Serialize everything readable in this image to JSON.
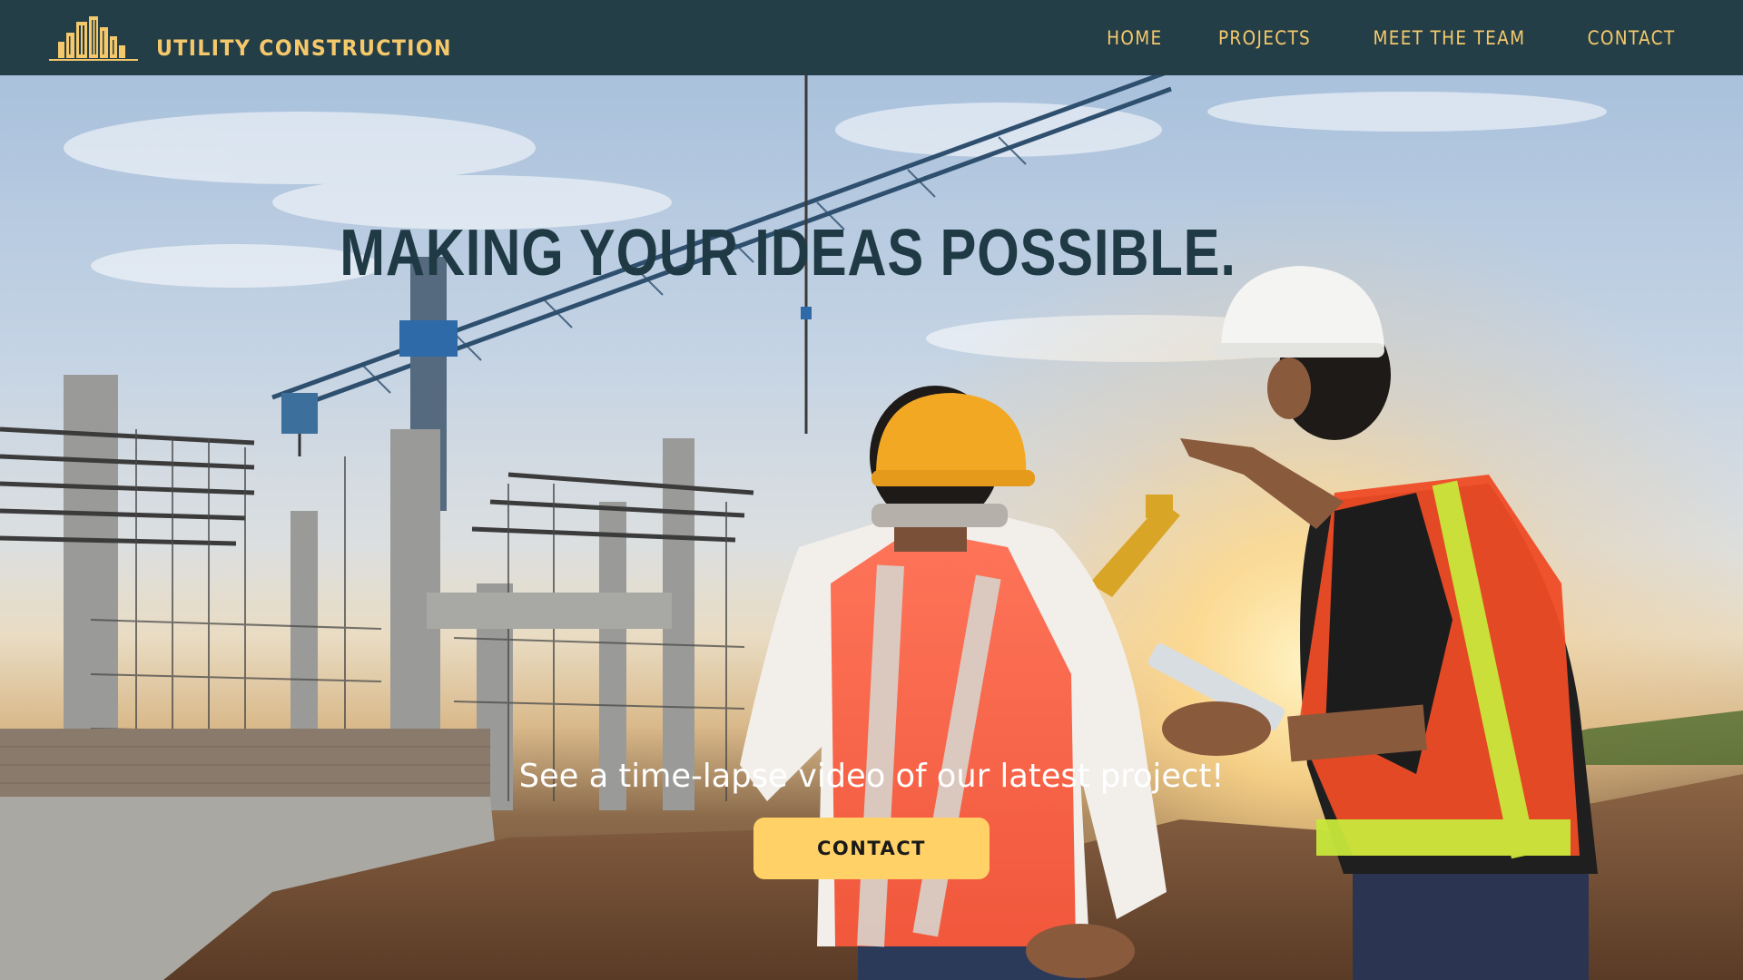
{
  "header": {
    "brand_name": "UTILITY CONSTRUCTION",
    "logo_icon": "city-buildings-logo",
    "nav": [
      {
        "label": "HOME"
      },
      {
        "label": "PROJECTS"
      },
      {
        "label": "MEET THE TEAM"
      },
      {
        "label": "CONTACT"
      }
    ]
  },
  "hero": {
    "title": "MAKING YOUR IDEAS POSSIBLE.",
    "subtitle": "See a time-lapse video of our latest project!",
    "cta_label": "CONTACT",
    "background_image": "construction-site-engineers-photo"
  },
  "colors": {
    "header_bg": "#243e48",
    "accent": "#f5c96b",
    "cta_bg": "#ffd166",
    "title": "#1f3a44"
  }
}
